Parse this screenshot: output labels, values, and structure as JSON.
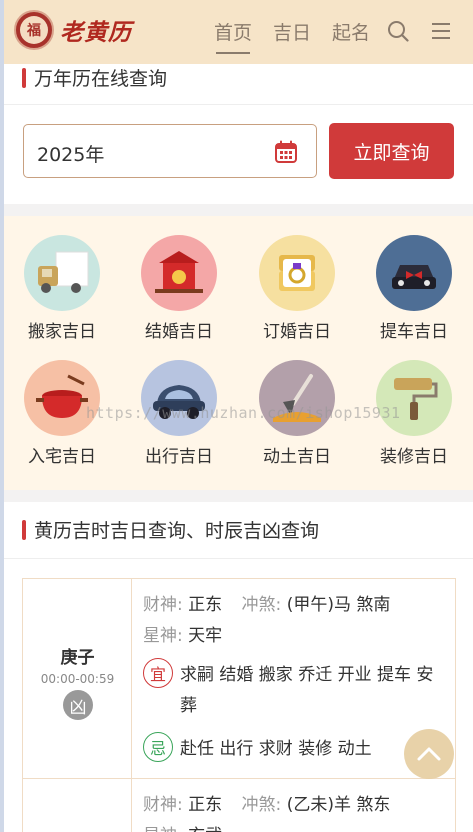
{
  "header": {
    "logo_text": "老黄历",
    "logo_seal_char": "福",
    "nav": [
      {
        "label": "首页",
        "active": true
      },
      {
        "label": "吉日",
        "active": false
      },
      {
        "label": "起名",
        "active": false
      }
    ],
    "icons": [
      "search-icon",
      "menu-icon"
    ]
  },
  "calendar_query": {
    "title": "万年历在线查询",
    "year_value": "2025年",
    "button_label": "立即查询"
  },
  "categories": [
    {
      "label": "搬家吉日",
      "icon": "moving-truck-icon",
      "color": "#c9e6e0"
    },
    {
      "label": "结婚吉日",
      "icon": "wedding-sedan-icon",
      "color": "#f4a7a7"
    },
    {
      "label": "订婚吉日",
      "icon": "ring-box-icon",
      "color": "#f6e0a0"
    },
    {
      "label": "提车吉日",
      "icon": "new-car-icon",
      "color": "#4e6e95"
    },
    {
      "label": "入宅吉日",
      "icon": "cooking-pot-icon",
      "color": "#f6c0a5"
    },
    {
      "label": "出行吉日",
      "icon": "car-icon",
      "color": "#b7c4e0"
    },
    {
      "label": "动土吉日",
      "icon": "shovel-icon",
      "color": "#b3a0aa"
    },
    {
      "label": "装修吉日",
      "icon": "paint-roller-icon",
      "color": "#d4e8b8"
    }
  ],
  "hours_section": {
    "title": "黄历吉时吉日查询、时辰吉凶查询",
    "labels": {
      "wealth": "财神:",
      "clash": "冲煞:",
      "star": "星神:",
      "yi": "宜",
      "ji": "忌"
    },
    "rows": [
      {
        "name": "庚子",
        "time": "00:00-00:59",
        "verdict": "凶",
        "wealth": "正东",
        "clash": "(甲午)马 煞南",
        "star": "天牢",
        "yi": "求嗣 结婚 搬家 乔迁 开业 提车 安葬",
        "ji": "赴任 出行 求财 装修 动土"
      },
      {
        "wealth": "正东",
        "clash": "(乙未)羊 煞东",
        "star": "玄武"
      }
    ]
  },
  "watermark": "https://www.huzhan.com/ishop15931",
  "colors": {
    "accent": "#d03a3a",
    "header_bg": "#f6e4c8",
    "category_bg": "#fff6e8"
  }
}
